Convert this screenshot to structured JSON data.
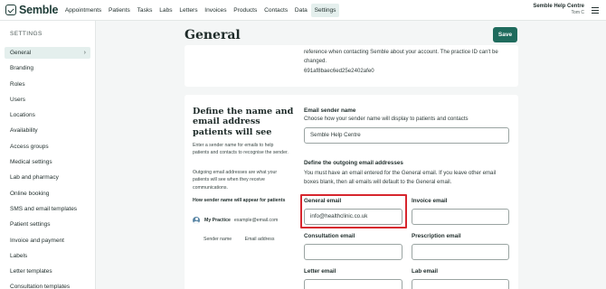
{
  "app": {
    "logo_text": "Semble",
    "nav": [
      "Appointments",
      "Patients",
      "Tasks",
      "Labs",
      "Letters",
      "Invoices",
      "Products",
      "Contacts",
      "Data",
      "Settings"
    ],
    "active_nav": "Settings",
    "account_name": "Semble Help Centre",
    "account_user": "Tom C"
  },
  "sidebar": {
    "heading": "SETTINGS",
    "items": [
      {
        "label": "General",
        "active": true
      },
      {
        "label": "Branding"
      },
      {
        "label": "Roles"
      },
      {
        "label": "Users"
      },
      {
        "label": "Locations"
      },
      {
        "label": "Availability"
      },
      {
        "label": "Access groups"
      },
      {
        "label": "Medical settings"
      },
      {
        "label": "Lab and pharmacy"
      },
      {
        "label": "Online booking"
      },
      {
        "label": "SMS and email templates"
      },
      {
        "label": "Patient settings"
      },
      {
        "label": "Invoice and payment"
      },
      {
        "label": "Labels"
      },
      {
        "label": "Letter templates"
      },
      {
        "label": "Consultation templates"
      }
    ],
    "chevron": "›"
  },
  "main": {
    "title": "General",
    "save_label": "Save",
    "practice_id_text": "reference when contacting Semble about your account. The practice ID can't be changed.",
    "practice_id": "691af8baec6ed25e2402afe0",
    "email_section": {
      "title": "Define the name and email address patients will see",
      "desc1": "Enter a sender name for emails to help patients and contacts to recognise the sender.",
      "desc2": "Outgoing email addresses are what your patients will see when they receive communications.",
      "how_title": "How sender name will appear for patients",
      "example_name": "My Practice",
      "example_email": "example@email.com",
      "label_sender_name": "Sender name",
      "label_email_address": "Email address",
      "sender_name_label": "Email sender name",
      "sender_name_hint": "Choose how your sender name will display to patients and contacts",
      "sender_name_value": "Semble Help Centre",
      "outgoing_title": "Define the outgoing email addresses",
      "outgoing_hint": "You must have an email entered for the General email. If you leave other email boxes blank, then all emails will default to the General email.",
      "general_email_label": "General email",
      "general_email_value": "info@healthclinic.co.uk",
      "invoice_email_label": "Invoice email",
      "consultation_email_label": "Consultation email",
      "prescription_email_label": "Prescription email",
      "letter_email_label": "Letter email",
      "lab_email_label": "Lab email"
    }
  },
  "colors": {
    "primary": "#1f6b5d",
    "highlight": "#d7262e",
    "active_bg": "#e4efed"
  }
}
